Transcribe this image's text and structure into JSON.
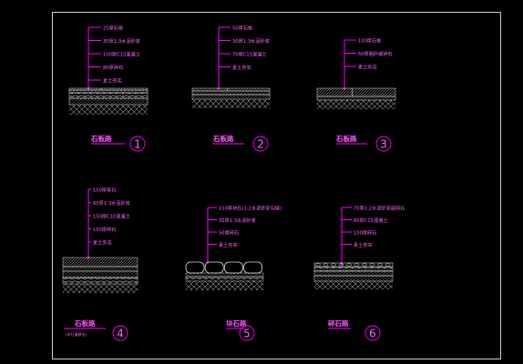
{
  "colors": {
    "background": "#000000",
    "frame": "#cfcfcf",
    "leader": "#ff00ff",
    "label": "#ff66ff",
    "layer_line": "#d8d8d8",
    "hatch": "#bfbfbf",
    "title": "#ff55ff"
  },
  "details": [
    {
      "title": "石板路",
      "number": "1",
      "labels": [
        "25厚石板",
        "30厚1:3水泥砂浆",
        "100厚C15混凝土",
        "80厚碎石",
        "素土夯实"
      ]
    },
    {
      "title": "石板路",
      "number": "2",
      "labels": [
        "50厚石板",
        "30厚1:3水泥砂浆",
        "70厚C15混凝土",
        "素土夯实"
      ]
    },
    {
      "title": "石板路",
      "number": "3",
      "labels": [
        "100厚石板",
        "50厚粗砂或碎石",
        "素土夯实"
      ]
    },
    {
      "title": "石板路",
      "number": "4",
      "note": "(车行道做法)",
      "labels": [
        "150厚条石",
        "60厚1:3水泥砂浆",
        "150厚C10混凝土",
        "150厚碎石",
        "素土夯实"
      ]
    },
    {
      "title": "块石路",
      "number": "5",
      "labels": [
        "150厚块石(1:2水泥砂浆勾缝)",
        "30厚1:3水泥砂浆",
        "50厚碎石",
        "素土夯实"
      ]
    },
    {
      "title": "碎石路",
      "number": "6",
      "labels": [
        "70厚1:2水泥砂浆嵌碎石",
        "60厚C15混凝土",
        "100厚碎石",
        "素土夯实"
      ]
    }
  ]
}
